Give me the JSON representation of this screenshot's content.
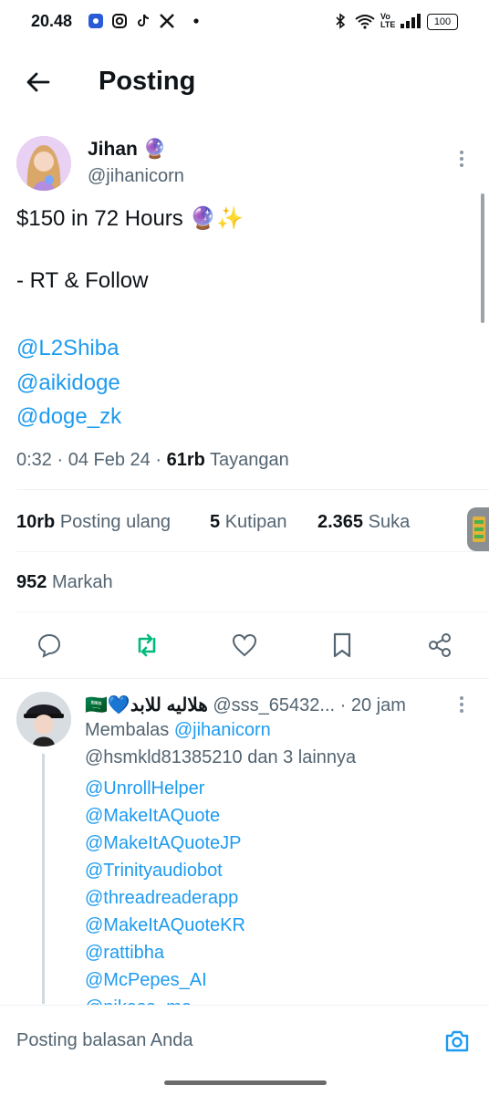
{
  "status_bar": {
    "time": "20.48",
    "battery": "100",
    "network": "Vo LTE"
  },
  "header": {
    "title": "Posting"
  },
  "tweet": {
    "name": "Jihan",
    "name_emoji": "🔮",
    "handle": "@jihanicorn",
    "line1": "$150 in 72 Hours 🔮✨",
    "line2": "- RT & Follow",
    "mentions": [
      "@L2Shiba",
      "@aikidoge",
      "@doge_zk"
    ],
    "time": "0:32",
    "date": "04 Feb 24",
    "views": "61rb",
    "views_label": "Tayangan",
    "reposts": "10rb",
    "reposts_label": "Posting ulang",
    "quotes": "5",
    "quotes_label": "Kutipan",
    "likes": "2.365",
    "likes_label": "Suka",
    "bookmarks": "952",
    "bookmarks_label": "Markah"
  },
  "reply": {
    "display_name": "🇸🇦💙هلاليه للابد",
    "handle": "@sss_65432...",
    "age": "· 20 jam",
    "replying_prefix": "Membalas",
    "replying_to": "@jihanicorn",
    "replying_more": "@hsmkld81385210 dan 3 lainnya",
    "mentions": [
      "@UnrollHelper",
      "@MakeItAQuote",
      "@MakeItAQuoteJP",
      "@Trinityaudiobot",
      "@threadreaderapp",
      "@MakeItAQuoteKR",
      "@rattibha",
      "@McPepes_AI",
      "@nikasa_me"
    ]
  },
  "composer": {
    "placeholder": "Posting balasan Anda"
  },
  "colors": {
    "accent": "#1d9bf0",
    "repost_green": "#00ba7c",
    "muted": "#536471"
  }
}
